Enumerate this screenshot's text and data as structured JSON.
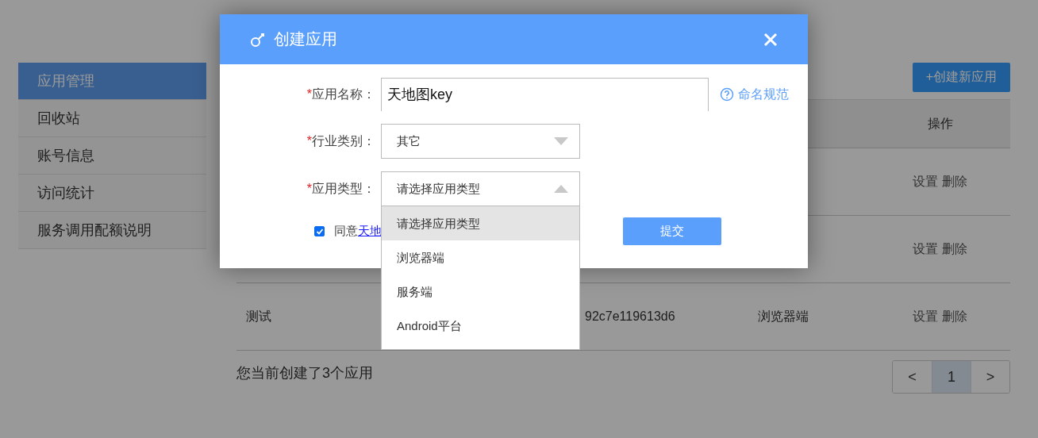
{
  "sidebar": {
    "items": [
      {
        "label": "应用管理",
        "selected": true
      },
      {
        "label": "回收站",
        "selected": false
      },
      {
        "label": "账号信息",
        "selected": false
      },
      {
        "label": "访问统计",
        "selected": false
      },
      {
        "label": "服务调用配额说明",
        "selected": false
      }
    ]
  },
  "create_button": "+创建新应用",
  "table": {
    "action_header": "操作",
    "rows": [
      {
        "actions": [
          "设置",
          "删除"
        ]
      },
      {
        "actions": [
          "设置",
          "删除"
        ]
      },
      {
        "name": "测试",
        "key": "92c7e119613d6",
        "type": "浏览器端",
        "actions": [
          "设置",
          "删除"
        ]
      }
    ]
  },
  "footer_text": "您当前创建了3个应用",
  "pagination": {
    "prev": "<",
    "pages": [
      {
        "label": "1",
        "selected": true
      }
    ],
    "next": ">"
  },
  "dialog": {
    "title": "创建应用",
    "fields": [
      {
        "kind": "text",
        "mark": "*",
        "label": "应用名称：",
        "value": "天地图key",
        "help": "命名规范"
      },
      {
        "kind": "select",
        "mark": "*",
        "label": "行业类别：",
        "value": "其它",
        "expanded": false
      },
      {
        "kind": "select",
        "mark": "*",
        "label": "应用类型：",
        "value": "请选择应用类型",
        "expanded": true,
        "options": [
          {
            "label": "请选择应用类型",
            "selected": true
          },
          {
            "label": "浏览器端",
            "selected": false
          },
          {
            "label": "服务端",
            "selected": false
          },
          {
            "label": "Android平台",
            "selected": false
          }
        ]
      }
    ],
    "agree": {
      "checked": true,
      "text": "同意",
      "link": "天地"
    },
    "submit": "提交"
  }
}
